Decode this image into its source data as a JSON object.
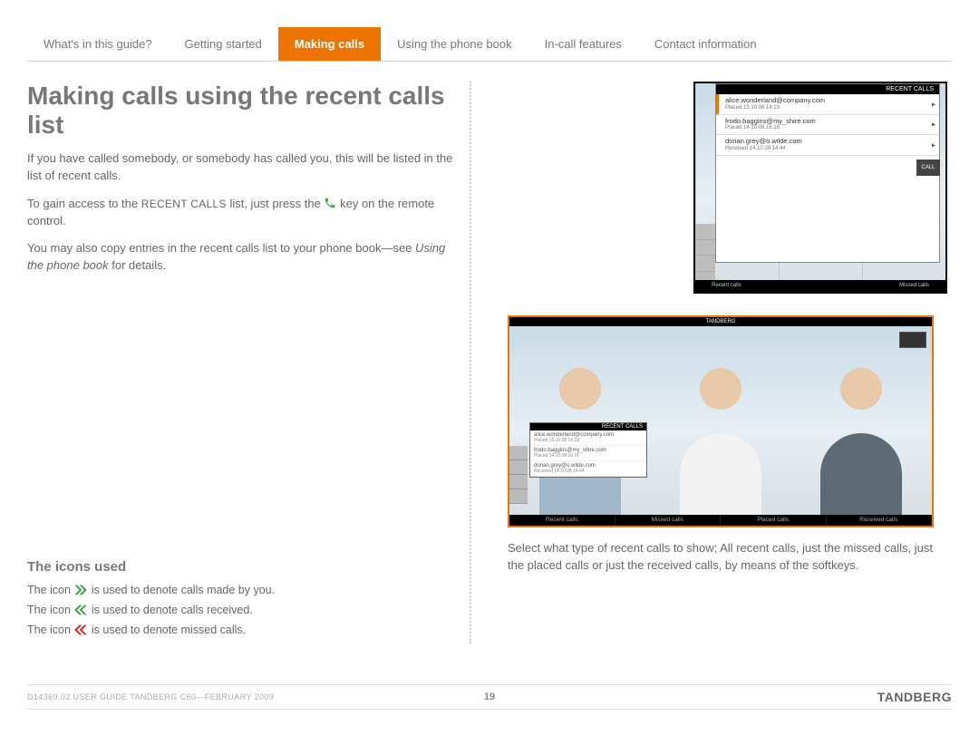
{
  "tabs": [
    {
      "label": "What's in this guide?"
    },
    {
      "label": "Getting started"
    },
    {
      "label": "Making calls",
      "active": true
    },
    {
      "label": "Using the phone book"
    },
    {
      "label": "In-call features"
    },
    {
      "label": "Contact information"
    }
  ],
  "heading": "Making calls using the recent calls list",
  "para1": "If you have called somebody, or somebody has called you, this will be listed in the list of recent calls.",
  "para2a": "To gain access to the ",
  "para2_sc": "RECENT CALLS",
  "para2b": " list, just press the ",
  "para2c": " key on the remote control.",
  "para3a": "You may also copy entries in the recent calls list to your phone book—see ",
  "para3_em": "Using the phone book",
  "para3b": " for details.",
  "icons_heading": "The icons used",
  "icon_line1a": "The icon ",
  "icon_line1b": " is used to denote calls made by you.",
  "icon_line2a": "The icon ",
  "icon_line2b": " is used to denote calls received.",
  "icon_line3a": "The icon ",
  "icon_line3b": " is used to denote missed calls.",
  "recent_calls_header": "RECENT CALLS",
  "entries": [
    {
      "name": "alice.wonderland@company.com",
      "sub": "Placed 15.10.08 14:29"
    },
    {
      "name": "frodo.baggins@my_shire.com",
      "sub": "Placed 14.10.08 16:16"
    },
    {
      "name": "dorian.grey@o.wilde.com",
      "sub": "Received 14.10.08 14:44"
    }
  ],
  "call_label": "CALL",
  "softkeys1": [
    "Recent calls",
    "",
    "",
    "Missed calls"
  ],
  "brand_top": "TANDBERG",
  "softkeys2": [
    "Recent calls",
    "Missed calls",
    "Placed calls",
    "Received calls"
  ],
  "caption": "Select what type of recent calls to show; All recent calls, just the missed calls, just the placed calls or just the received calls, by means of the softkeys.",
  "footer_doc": "D14369.02 USER GUIDE TANDBERG C60—FEBRUARY 2009",
  "footer_page": "19",
  "footer_brand": "TANDBERG"
}
